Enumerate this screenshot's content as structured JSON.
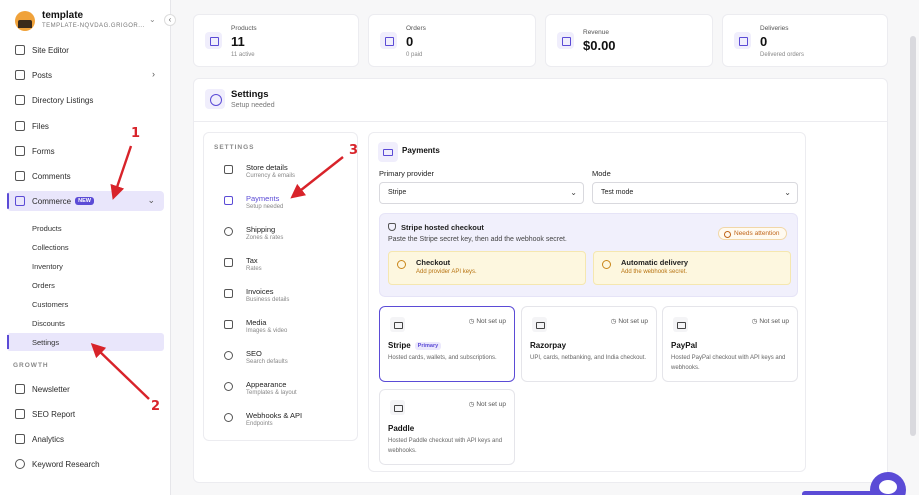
{
  "sidebar": {
    "brand_name": "template",
    "brand_sub": "TEMPLATE-NQVDAG.GRIGOR...",
    "brand_caret": "⌄",
    "collapse_icon": "‹",
    "items": [
      {
        "label": "Site Editor",
        "icon": "palette-icon"
      },
      {
        "label": "Posts",
        "icon": "document-icon",
        "chevron": "›"
      },
      {
        "label": "Directory Listings",
        "icon": "book-icon"
      },
      {
        "label": "Files",
        "icon": "folder-icon"
      },
      {
        "label": "Forms",
        "icon": "clipboard-icon"
      },
      {
        "label": "Comments",
        "icon": "comment-icon"
      }
    ],
    "commerce": {
      "label": "Commerce",
      "badge": "NEW",
      "chevron": "⌄"
    },
    "sub_items": [
      "Products",
      "Collections",
      "Inventory",
      "Orders",
      "Customers",
      "Discounts",
      "Settings"
    ],
    "growth_header": "GROWTH",
    "growth_items": [
      {
        "label": "Newsletter",
        "icon": "mail-icon"
      },
      {
        "label": "SEO Report",
        "icon": "report-icon"
      },
      {
        "label": "Analytics",
        "icon": "chart-icon"
      },
      {
        "label": "Keyword Research",
        "icon": "search-icon"
      }
    ]
  },
  "stats": [
    {
      "label": "Products",
      "value": "11",
      "sub": "11 active",
      "icon": "box-icon"
    },
    {
      "label": "Orders",
      "value": "0",
      "sub": "0 paid",
      "icon": "receipt-icon"
    },
    {
      "label": "Revenue",
      "value": "$0.00",
      "sub": "",
      "icon": "cart-icon"
    },
    {
      "label": "Deliveries",
      "value": "0",
      "sub": "Delivered orders",
      "icon": "download-icon"
    }
  ],
  "settings_header": {
    "title": "Settings",
    "sub": "Setup needed"
  },
  "settings_menu": {
    "header": "SETTINGS",
    "items": [
      {
        "label": "Store details",
        "sub": "Currency & emails"
      },
      {
        "label": "Payments",
        "sub": "Setup needed"
      },
      {
        "label": "Shipping",
        "sub": "Zones & rates"
      },
      {
        "label": "Tax",
        "sub": "Rates"
      },
      {
        "label": "Invoices",
        "sub": "Business details"
      },
      {
        "label": "Media",
        "sub": "Images & video"
      },
      {
        "label": "SEO",
        "sub": "Search defaults"
      },
      {
        "label": "Appearance",
        "sub": "Templates & layout"
      },
      {
        "label": "Webhooks & API",
        "sub": "Endpoints"
      }
    ]
  },
  "payments": {
    "title": "Payments",
    "provider_label": "Primary provider",
    "provider_value": "Stripe",
    "mode_label": "Mode",
    "mode_value": "Test mode",
    "checkout_title": "Stripe hosted checkout",
    "checkout_desc": "Paste the Stripe secret key, then add the webhook secret.",
    "attention": "Needs attention",
    "notices": [
      {
        "title": "Checkout",
        "sub": "Add provider API keys."
      },
      {
        "title": "Automatic delivery",
        "sub": "Add the webhook secret."
      }
    ],
    "providers": [
      {
        "name": "Stripe",
        "badge": "Primary",
        "status": "Not set up",
        "desc": "Hosted cards, wallets, and subscriptions."
      },
      {
        "name": "Razorpay",
        "status": "Not set up",
        "desc": "UPI, cards, netbanking, and India checkout."
      },
      {
        "name": "PayPal",
        "status": "Not set up",
        "desc": "Hosted PayPal checkout with API keys and webhooks."
      },
      {
        "name": "Paddle",
        "status": "Not set up",
        "desc": "Hosted Paddle checkout with API keys and webhooks."
      }
    ]
  },
  "annotations": {
    "a1": "1",
    "a2": "2",
    "a3": "3"
  },
  "colors": {
    "accent": "#5b4bd6",
    "annotation": "#d8232a",
    "notice_bg": "#fdf7df"
  }
}
